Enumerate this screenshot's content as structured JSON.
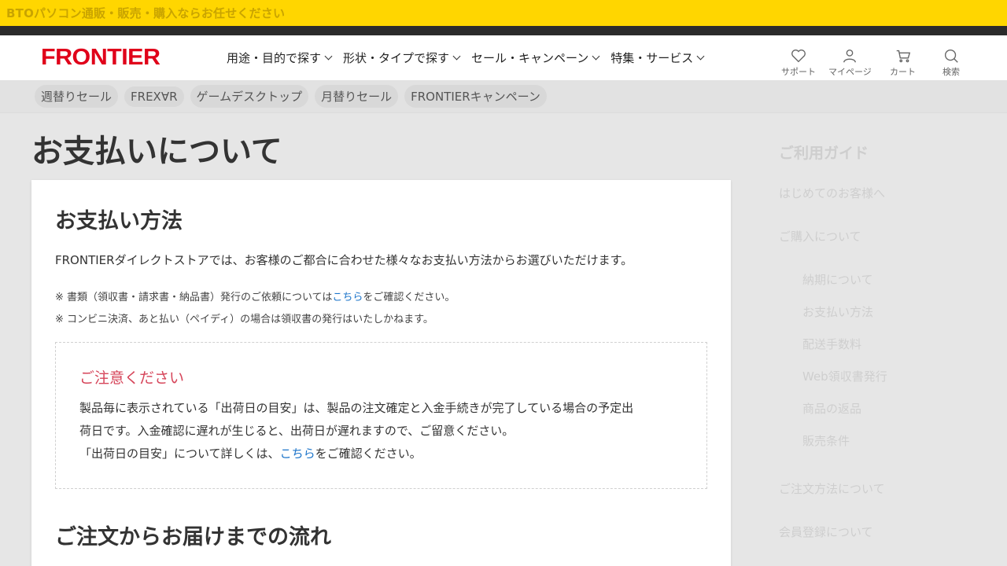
{
  "topbar": {
    "text": "BTOパソコン通販・販売・購入ならお任せください"
  },
  "header": {
    "logo": "FRONTIER",
    "nav": [
      {
        "label": "用途・目的で探す"
      },
      {
        "label": "形状・タイプで探す"
      },
      {
        "label": "セール・キャンペーン"
      },
      {
        "label": "特集・サービス"
      }
    ],
    "icons": {
      "support": "サポート",
      "mypage": "マイページ",
      "cart": "カート",
      "search": "検索"
    }
  },
  "tags": [
    "週替りセール",
    "FREX∀R",
    "ゲームデスクトップ",
    "月替りセール",
    "FRONTIERキャンペーン"
  ],
  "page_title": "お支払いについて",
  "content": {
    "section_title": "お支払い方法",
    "intro": "FRONTIERダイレクトストアでは、お客様のご都合に合わせた様々なお支払い方法からお選びいただけます。",
    "note1_before": "※ 書類（領収書・請求書・納品書）発行のご依頼については",
    "note1_link": "こちら",
    "note1_after": "をご確認ください。",
    "note2": "※ コンビニ決済、あと払い（ペイディ）の場合は領収書の発行はいたしかねます。",
    "caution_title": "ご注意ください",
    "caution_line1": "製品毎に表示されている「出荷日の目安」は、製品の注文確定と入金手続きが完了している場合の予定出",
    "caution_line2": "荷日です。入金確認に遅れが生じると、出荷日が遅れますので、ご留意ください。",
    "caution_line3_before": "「出荷日の目安」について詳しくは、",
    "caution_link": "こちら",
    "caution_line3_after": "をご確認ください。",
    "section2_title": "ご注文からお届けまでの流れ"
  },
  "sidebar": {
    "title": "ご利用ガイド",
    "items": [
      {
        "label": "はじめてのお客様へ"
      },
      {
        "label": "ご購入について"
      }
    ],
    "subitems": [
      "納期について",
      "お支払い方法",
      "配送手数料",
      "Web領収書発行",
      "商品の返品",
      "販売条件"
    ],
    "items2": [
      {
        "label": "ご注文方法について"
      },
      {
        "label": "会員登録について"
      }
    ]
  }
}
